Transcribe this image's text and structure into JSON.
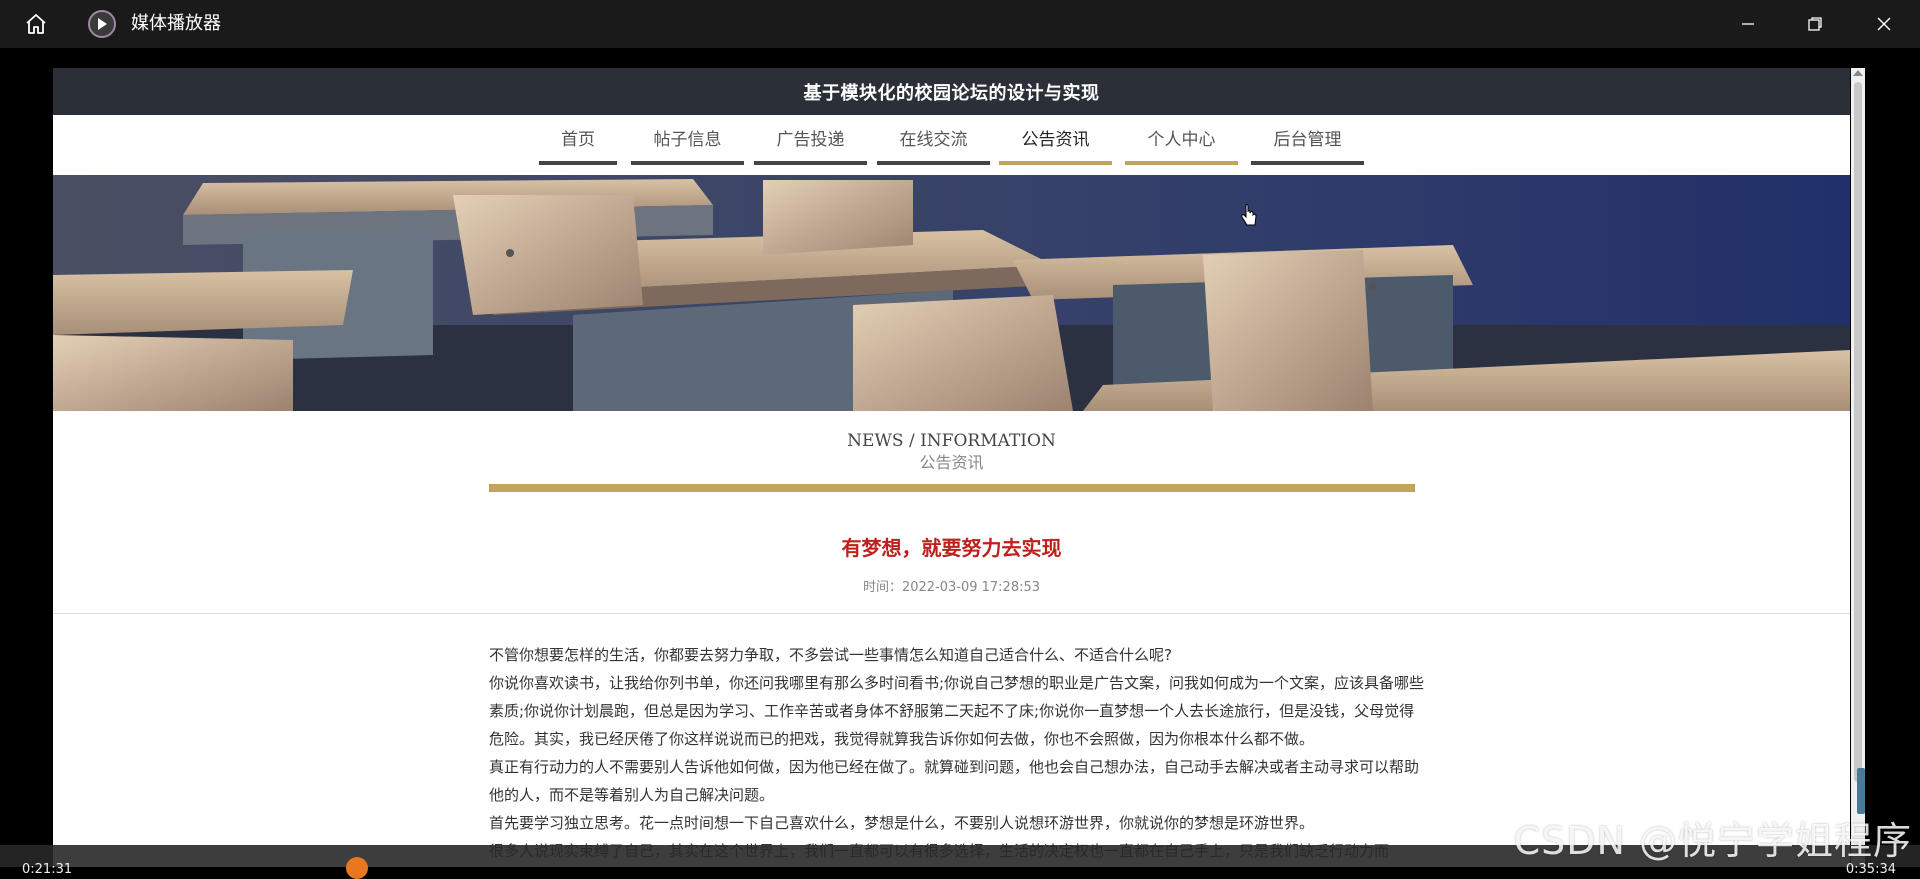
{
  "window": {
    "app_title": "媒体播放器"
  },
  "site": {
    "title": "基于模块化的校园论坛的设计与实现",
    "nav": [
      {
        "label": "首页"
      },
      {
        "label": "帖子信息"
      },
      {
        "label": "广告投递"
      },
      {
        "label": "在线交流"
      },
      {
        "label": "公告资讯"
      },
      {
        "label": "个人中心"
      },
      {
        "label": "后台管理"
      }
    ]
  },
  "section": {
    "title_en": "NEWS / INFORMATION",
    "title_cn": "公告资讯"
  },
  "article": {
    "title": "有梦想，就要努力去实现",
    "time": "时间：2022-03-09 17:28:53",
    "paragraphs": [
      "不管你想要怎样的生活，你都要去努力争取，不多尝试一些事情怎么知道自己适合什么、不适合什么呢?",
      "你说你喜欢读书，让我给你列书单，你还问我哪里有那么多时间看书;你说自己梦想的职业是广告文案，问我如何成为一个文案，应该具备哪些素质;你说你计划晨跑，但总是因为学习、工作辛苦或者身体不舒服第二天起不了床;你说你一直梦想一个人去长途旅行，但是没钱，父母觉得危险。其实，我已经厌倦了你这样说说而已的把戏，我觉得就算我告诉你如何去做，你也不会照做，因为你根本什么都不做。",
      "真正有行动力的人不需要别人告诉他如何做，因为他已经在做了。就算碰到问题，他也会自己想办法，自己动手去解决或者主动寻求可以帮助他的人，而不是等着别人为自己解决问题。",
      "首先要学习独立思考。花一点时间想一下自己喜欢什么，梦想是什么，不要别人说想环游世界，你就说你的梦想是环游世界。",
      "很多人说现实束缚了自己，其实在这个世界上，我们一直都可以有很多选择，生活的决定权也一直都在自己手上，只是我们缺乏行动力而"
    ]
  },
  "player": {
    "time_left": "0:21:31",
    "time_right": "0:35:34"
  },
  "watermark": "CSDN @悦宁学姐程序",
  "colors": {
    "gold": "#c2a55d",
    "header": "#2b3038",
    "title_red": "#c0201c"
  }
}
